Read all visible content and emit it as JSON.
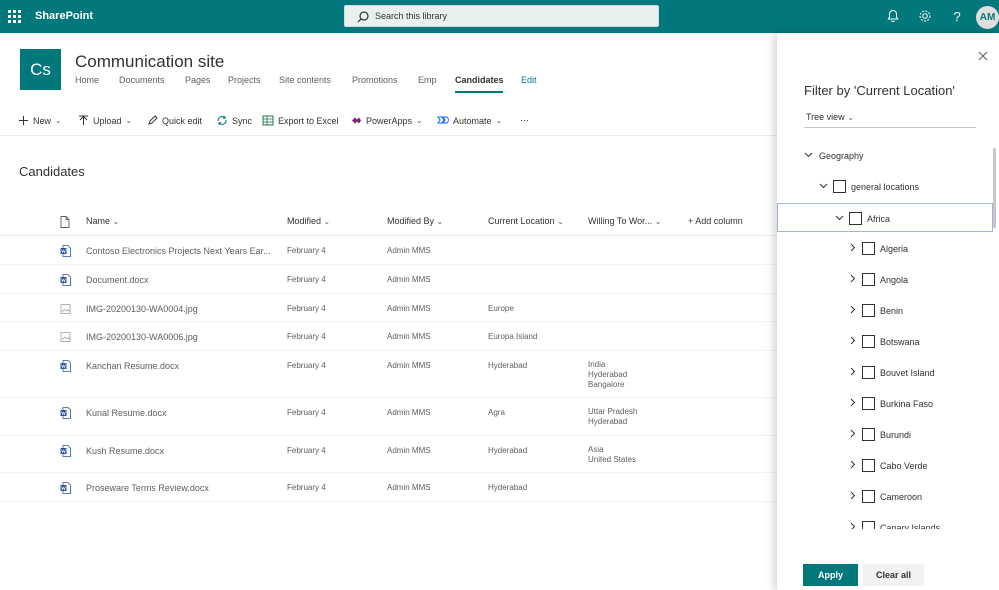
{
  "suitebar": {
    "brand": "SharePoint",
    "search_placeholder": "Search this library",
    "avatar_initials": "AM",
    "icons": [
      "app-launcher-icon",
      "bell-icon",
      "gear-icon",
      "help-icon"
    ]
  },
  "site": {
    "logo_text": "Cs",
    "title": "Communication site",
    "nav": [
      "Home",
      "Documents",
      "Pages",
      "Projects",
      "Site contents",
      "Promotions",
      "Emp",
      "Candidates",
      "Edit"
    ],
    "active_nav": "Candidates"
  },
  "commands": {
    "new": "New",
    "upload": "Upload",
    "quick_edit": "Quick edit",
    "sync": "Sync",
    "export": "Export to Excel",
    "powerapps": "PowerApps",
    "automate": "Automate",
    "more": "···"
  },
  "list": {
    "title": "Candidates",
    "columns": {
      "name": "Name",
      "modified": "Modified",
      "modified_by": "Modified By",
      "current_location": "Current Location",
      "willing": "Willing To Wor...",
      "add_column": "+ Add column"
    },
    "rows": [
      {
        "name": "Contoso Electronics Projects Next Years Ear...",
        "type": "word",
        "modified": "February 4",
        "modified_by": "Admin MMS",
        "location": "",
        "willing": []
      },
      {
        "name": "Document.docx",
        "type": "word",
        "modified": "February 4",
        "modified_by": "Admin MMS",
        "location": "",
        "willing": []
      },
      {
        "name": "IMG-20200130-WA0004.jpg",
        "type": "image",
        "modified": "February 4",
        "modified_by": "Admin MMS",
        "location": "Europe",
        "willing": []
      },
      {
        "name": "IMG-20200130-WA0006.jpg",
        "type": "image",
        "modified": "February 4",
        "modified_by": "Admin MMS",
        "location": "Europa Island",
        "willing": []
      },
      {
        "name": "Kanchan Resume.docx",
        "type": "word",
        "modified": "February 4",
        "modified_by": "Admin MMS",
        "location": "Hyderabad",
        "willing": [
          "India",
          "Hyderabad",
          "Bangalore"
        ]
      },
      {
        "name": "Kunal Resume.docx",
        "type": "word",
        "modified": "February 4",
        "modified_by": "Admin MMS",
        "location": "Agra",
        "willing": [
          "Uttar Pradesh",
          "Hyderabad"
        ]
      },
      {
        "name": "Kush Resume.docx",
        "type": "word",
        "modified": "February 4",
        "modified_by": "Admin MMS",
        "location": "Hyderabad",
        "willing": [
          "Asia",
          "United States"
        ]
      },
      {
        "name": "Proseware Terms Review.docx",
        "type": "word",
        "modified": "February 4",
        "modified_by": "Admin MMS",
        "location": "Hyderabad",
        "willing": []
      }
    ]
  },
  "filter_panel": {
    "title": "Filter by 'Current Location'",
    "view": "Tree view",
    "tree": [
      {
        "label": "Geography",
        "level": 0,
        "expanded": true,
        "checkbox": false
      },
      {
        "label": "general locations",
        "level": 1,
        "expanded": true,
        "checkbox": true
      },
      {
        "label": "Africa",
        "level": 2,
        "expanded": true,
        "checkbox": true,
        "focused": true
      },
      {
        "label": "Algeria",
        "level": 3,
        "expanded": false,
        "checkbox": true
      },
      {
        "label": "Angola",
        "level": 3,
        "expanded": false,
        "checkbox": true
      },
      {
        "label": "Benin",
        "level": 3,
        "expanded": false,
        "checkbox": true
      },
      {
        "label": "Botswana",
        "level": 3,
        "expanded": false,
        "checkbox": true
      },
      {
        "label": "Bouvet Island",
        "level": 3,
        "expanded": false,
        "checkbox": true
      },
      {
        "label": "Burkina Faso",
        "level": 3,
        "expanded": false,
        "checkbox": true
      },
      {
        "label": "Burundi",
        "level": 3,
        "expanded": false,
        "checkbox": true
      },
      {
        "label": "Cabo Verde",
        "level": 3,
        "expanded": false,
        "checkbox": true
      },
      {
        "label": "Cameroon",
        "level": 3,
        "expanded": false,
        "checkbox": true
      },
      {
        "label": "Canary Islands",
        "level": 3,
        "expanded": false,
        "checkbox": true
      }
    ],
    "apply": "Apply",
    "clear": "Clear all"
  },
  "colors": {
    "accent": "#03787c",
    "text": "#323130",
    "muted": "#605e5c"
  }
}
